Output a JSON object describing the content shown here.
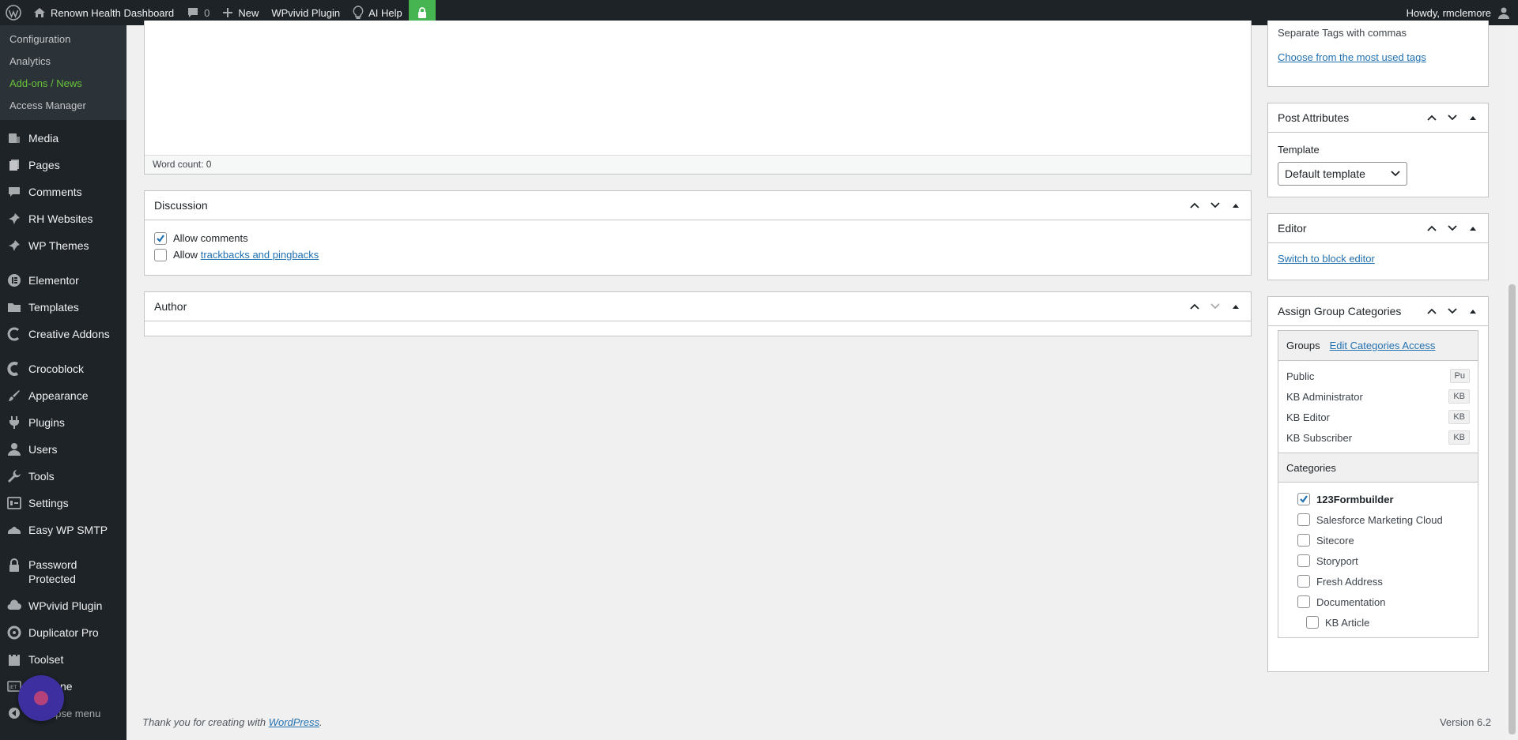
{
  "adminbar": {
    "site_name": "Renown Health Dashboard",
    "comments_count": "0",
    "new_label": "New",
    "wpvivid_label": "WPvivid Plugin",
    "ai_help_label": "AI Help",
    "howdy": "Howdy, rmclemore"
  },
  "menu": {
    "submenu": [
      "Configuration",
      "Analytics",
      "Add-ons / News",
      "Access Manager"
    ],
    "items": [
      {
        "label": "Media",
        "icon": "media-icon"
      },
      {
        "label": "Pages",
        "icon": "pages-icon"
      },
      {
        "label": "Comments",
        "icon": "comments-icon"
      },
      {
        "label": "RH Websites",
        "icon": "pin-icon"
      },
      {
        "label": "WP Themes",
        "icon": "pin-icon"
      },
      {
        "label": "Elementor",
        "icon": "elementor-icon"
      },
      {
        "label": "Templates",
        "icon": "folder-icon"
      },
      {
        "label": "Creative Addons",
        "icon": "creative-icon"
      },
      {
        "label": "Crocoblock",
        "icon": "crocoblock-icon"
      },
      {
        "label": "Appearance",
        "icon": "brush-icon"
      },
      {
        "label": "Plugins",
        "icon": "plugin-icon"
      },
      {
        "label": "Users",
        "icon": "user-icon"
      },
      {
        "label": "Tools",
        "icon": "wrench-icon"
      },
      {
        "label": "Settings",
        "icon": "settings-icon"
      },
      {
        "label": "Easy WP SMTP",
        "icon": "smtp-icon"
      },
      {
        "label": "Password Protected",
        "icon": "lock-icon"
      },
      {
        "label": "WPvivid Plugin",
        "icon": "cloud-icon"
      },
      {
        "label": "Duplicator Pro",
        "icon": "duplicator-icon"
      },
      {
        "label": "Toolset",
        "icon": "toolset-icon"
      },
      {
        "label": "JetEngine",
        "icon": "jet-icon"
      }
    ],
    "jet_partial": "ne",
    "collapse_partial": "ollapse menu"
  },
  "editor": {
    "word_count": "Word count: 0"
  },
  "discussion": {
    "title": "Discussion",
    "allow_comments": "Allow comments",
    "allow_prefix": "Allow",
    "trackbacks_link": "trackbacks and pingbacks"
  },
  "author": {
    "title": "Author"
  },
  "tags": {
    "hint": "Separate Tags with commas",
    "choose_link": "Choose from the most used tags"
  },
  "post_attributes": {
    "title": "Post Attributes",
    "template_label": "Template",
    "template_value": "Default template"
  },
  "editor_box": {
    "title": "Editor",
    "switch_link": "Switch to block editor"
  },
  "group_categories": {
    "title": "Assign Group Categories",
    "groups_label": "Groups",
    "edit_access_link": "Edit Categories Access",
    "groups": [
      {
        "name": "Public",
        "tag": "Pu"
      },
      {
        "name": "KB Administrator",
        "tag": "KB"
      },
      {
        "name": "KB Editor",
        "tag": "KB"
      },
      {
        "name": "KB Subscriber",
        "tag": "KB"
      }
    ],
    "categories_label": "Categories",
    "categories": [
      {
        "name": "123Formbuilder",
        "checked": true
      },
      {
        "name": "Salesforce Marketing Cloud",
        "checked": false
      },
      {
        "name": "Sitecore",
        "checked": false
      },
      {
        "name": "Storyport",
        "checked": false
      },
      {
        "name": "Fresh Address",
        "checked": false
      },
      {
        "name": "Documentation",
        "checked": false
      },
      {
        "name": "KB Article",
        "checked": false
      }
    ]
  },
  "footer": {
    "thanks_prefix": "Thank you for creating with",
    "wordpress_link": "WordPress",
    "version": "Version 6.2"
  }
}
